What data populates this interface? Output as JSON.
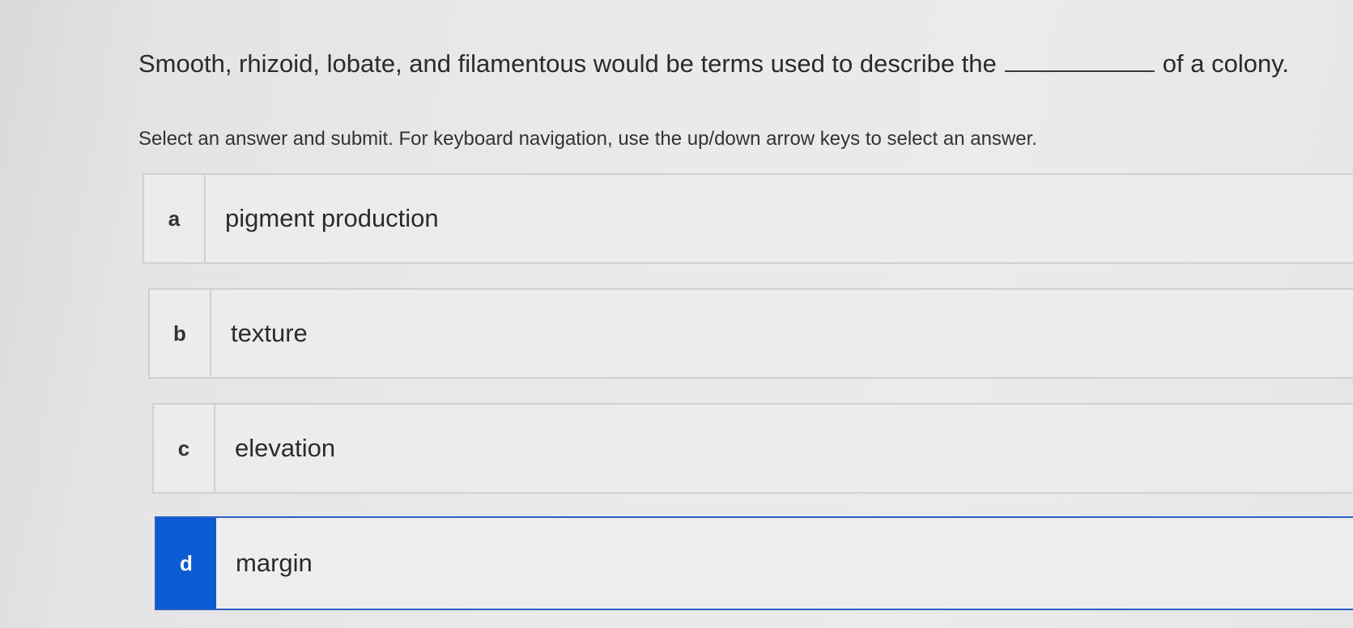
{
  "question": {
    "before_blank": "Smooth, rhizoid, lobate, and filamentous would be terms used to describe the",
    "after_blank": "of a colony."
  },
  "instructions": "Select an answer and submit. For keyboard navigation, use the up/down arrow keys to select an answer.",
  "options": [
    {
      "letter": "a",
      "text": "pigment production"
    },
    {
      "letter": "b",
      "text": "texture"
    },
    {
      "letter": "c",
      "text": "elevation"
    },
    {
      "letter": "d",
      "text": "margin"
    }
  ],
  "selected_option": "d",
  "colors": {
    "selected_accent": "#0b5bd3",
    "selected_border": "#2a5fc7",
    "option_border": "#d0d0d0"
  }
}
